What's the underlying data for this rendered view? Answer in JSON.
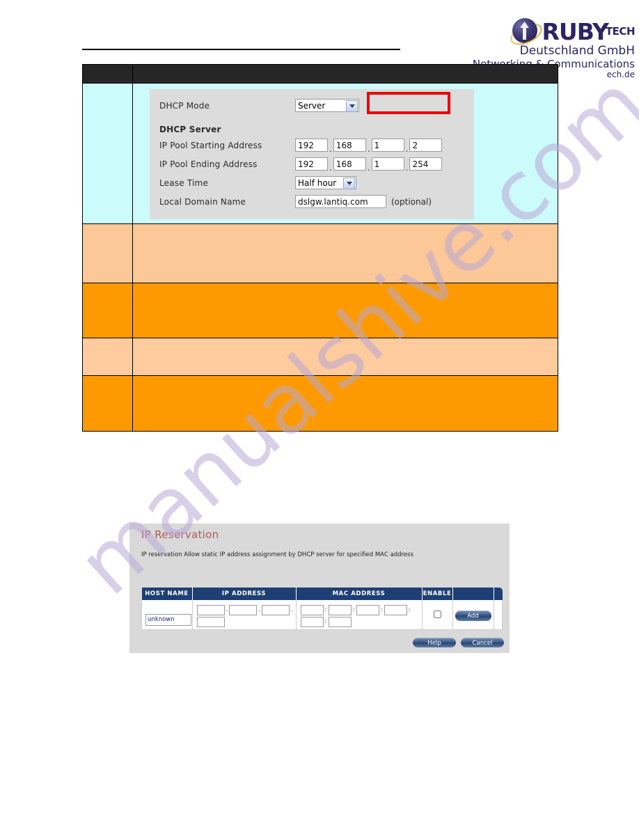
{
  "brand": {
    "name_main": "RUBY",
    "name_sub": "TECH",
    "line2": "Deutschland GmbH",
    "line3": "Networking & Communications",
    "line4": "ech.de"
  },
  "dhcp_form": {
    "mode_label": "DHCP Mode",
    "mode_value": "Server",
    "mode_options": [
      "Server"
    ],
    "section_title": "DHCP Server",
    "pool_start_label": "IP Pool Starting Address",
    "pool_start": [
      "192",
      "168",
      "1",
      "2"
    ],
    "pool_end_label": "IP Pool Ending Address",
    "pool_end": [
      "192",
      "168",
      "1",
      "254"
    ],
    "lease_label": "Lease Time",
    "lease_value": "Half hour",
    "lease_options": [
      "Half hour"
    ],
    "domain_label": "Local Domain Name",
    "domain_value": "dslgw.lantiq.com",
    "domain_note": "(optional)",
    "separator": ".",
    "highlight_color": "#ee0000"
  },
  "ip_reservation": {
    "title": "IP Reservation",
    "description": "IP reservation Allow static IP address assignment by DHCP server for specified MAC address",
    "columns": [
      "HOST NAME",
      "IP ADDRESS",
      "MAC ADDRESS",
      "ENABLE",
      ""
    ],
    "host_value": "unknown",
    "ip_segments": [
      "",
      "",
      "",
      ""
    ],
    "mac_segments": [
      "",
      "",
      "",
      "",
      "",
      ""
    ],
    "ip_separator": ".",
    "mac_separator": ":",
    "enable_checked": false,
    "add_label": "Add",
    "help_label": "Help",
    "cancel_label": "Cancel"
  },
  "table_rows": {
    "header_bg": "#262626",
    "cyan_bg": "#ccfbfb",
    "peach_bg": "#fcc897",
    "orange_bg": "#fe9a01",
    "peach2_bg": "#fdcb9e"
  },
  "watermark": {
    "text": "manualshive.com",
    "color": "#b9a8d6"
  }
}
